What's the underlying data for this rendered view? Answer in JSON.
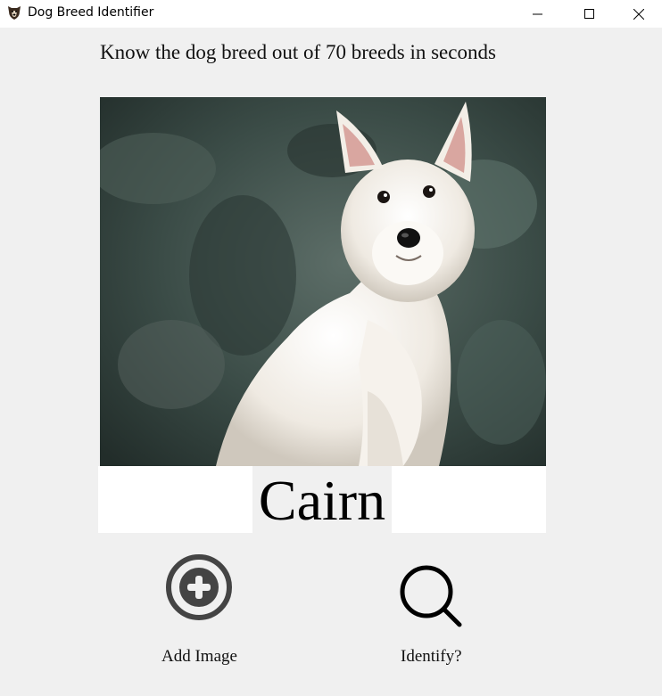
{
  "window": {
    "title": "Dog Breed Identifier",
    "icon": "dog-icon",
    "controls": [
      "minimize-icon",
      "maximize-icon",
      "close-icon"
    ]
  },
  "main": {
    "tagline": "Know the dog breed out of 70 breeds in seconds",
    "image": {
      "subject": "dog-photo"
    },
    "result": "Cairn"
  },
  "actions": {
    "add": {
      "label": "Add Image",
      "icon": "add-circle-icon"
    },
    "identify": {
      "label": "Identify?",
      "icon": "search-icon"
    }
  },
  "colors": {
    "background": "#f0f0f0",
    "panel": "#ffffff",
    "icon_gray": "#444444",
    "text": "#111111"
  }
}
